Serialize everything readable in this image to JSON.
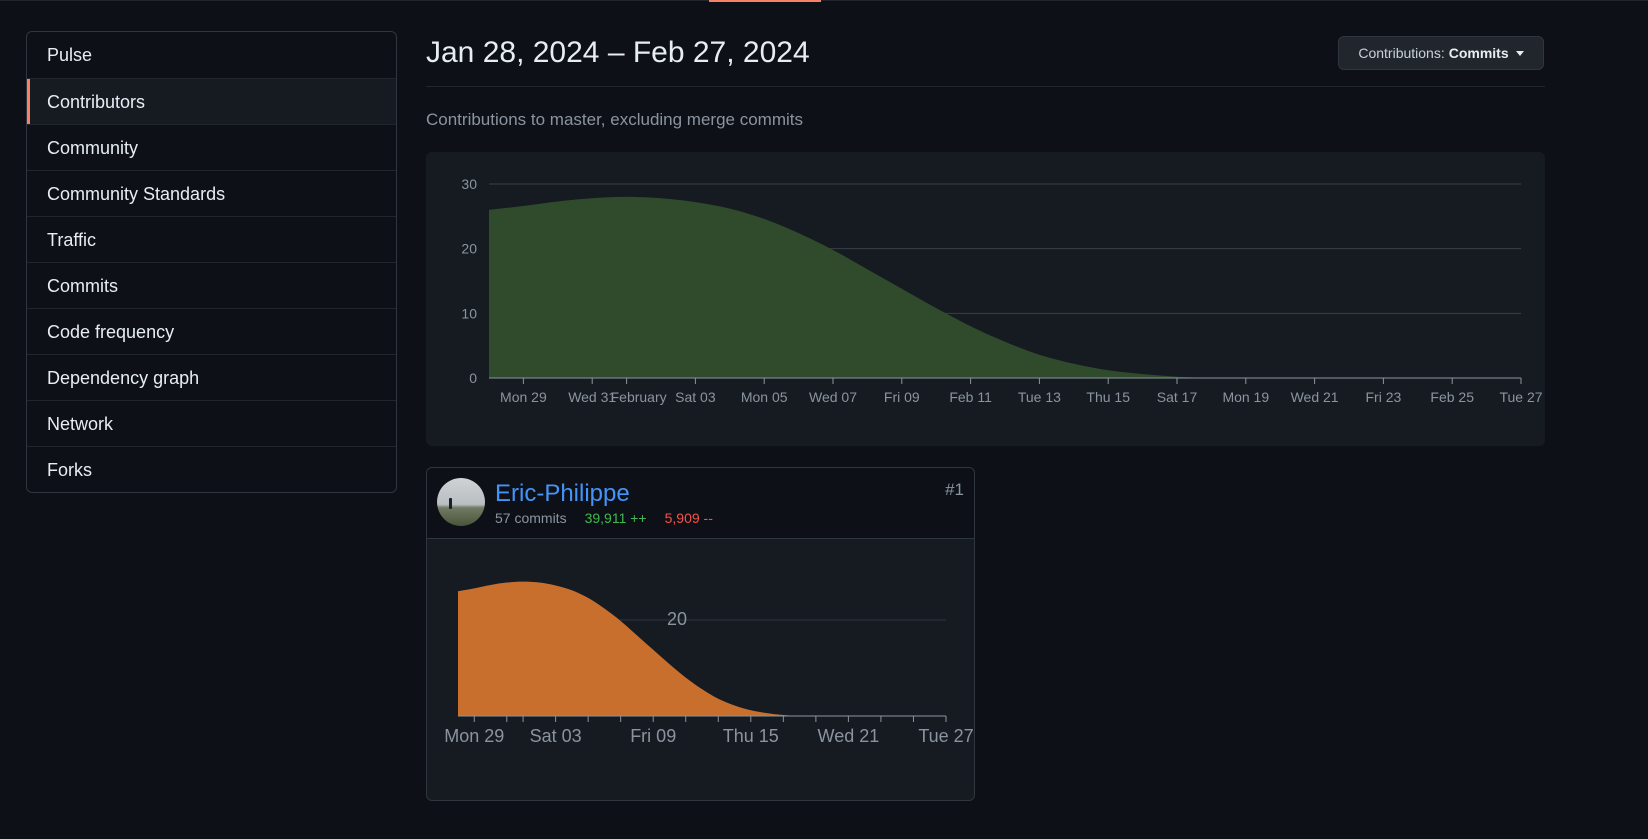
{
  "sidebar": {
    "items": [
      {
        "label": "Pulse",
        "active": false
      },
      {
        "label": "Contributors",
        "active": true
      },
      {
        "label": "Community",
        "active": false
      },
      {
        "label": "Community Standards",
        "active": false
      },
      {
        "label": "Traffic",
        "active": false
      },
      {
        "label": "Commits",
        "active": false
      },
      {
        "label": "Code frequency",
        "active": false
      },
      {
        "label": "Dependency graph",
        "active": false
      },
      {
        "label": "Network",
        "active": false
      },
      {
        "label": "Forks",
        "active": false
      }
    ]
  },
  "header": {
    "date_range": "Jan 28, 2024 – Feb 27, 2024",
    "contrib_prefix": "Contributions:",
    "contrib_value": "Commits",
    "subtitle": "Contributions to master, excluding merge commits"
  },
  "colors": {
    "accent": "#f78166",
    "overall_fill": "#2f4b2c",
    "contributor_fill": "#c96f2d",
    "link": "#4493f8",
    "additions": "#3fb950",
    "deletions": "#f85149"
  },
  "chart_data": [
    {
      "type": "area",
      "title": "",
      "xlabel": "",
      "ylabel": "",
      "ylim": [
        0,
        30
      ],
      "yticks": [
        0,
        10,
        20,
        30
      ],
      "grid": true,
      "xlim": [
        "Jan 28",
        "Feb 27"
      ],
      "xtick_labels": [
        "Mon 29",
        "Wed 31",
        "February",
        "Sat 03",
        "Mon 05",
        "Wed 07",
        "Fri 09",
        "Feb 11",
        "Tue 13",
        "Thu 15",
        "Sat 17",
        "Mon 19",
        "Wed 21",
        "Fri 23",
        "Feb 25",
        "Tue 27"
      ],
      "x": [
        "Jan 28",
        "Jan 29",
        "Jan 30",
        "Jan 31",
        "Feb 01",
        "Feb 02",
        "Feb 03",
        "Feb 04",
        "Feb 05",
        "Feb 06",
        "Feb 07",
        "Feb 08",
        "Feb 09",
        "Feb 10",
        "Feb 11",
        "Feb 12",
        "Feb 13",
        "Feb 14",
        "Feb 15",
        "Feb 16",
        "Feb 17",
        "Feb 18",
        "Feb 19",
        "Feb 20",
        "Feb 21",
        "Feb 22",
        "Feb 23",
        "Feb 24",
        "Feb 25",
        "Feb 26",
        "Feb 27"
      ],
      "series": [
        {
          "values": [
            26,
            26.6,
            27.3,
            27.8,
            28,
            27.8,
            27.2,
            26.2,
            24.6,
            22.4,
            19.8,
            16.8,
            13.8,
            10.8,
            8.0,
            5.6,
            3.6,
            2.2,
            1.2,
            0.6,
            0.2,
            0,
            0,
            0,
            0,
            0,
            0,
            0,
            0,
            0,
            0
          ]
        }
      ]
    },
    {
      "type": "area",
      "title": "",
      "xlabel": "",
      "ylabel": "",
      "ylim": [
        0,
        30
      ],
      "yticks": [
        20
      ],
      "grid": true,
      "xlim": [
        "Jan 28",
        "Feb 27"
      ],
      "xtick_labels": [
        "Mon 29",
        "Sat 03",
        "Fri 09",
        "Thu 15",
        "Wed 21",
        "Tue 27"
      ],
      "x": [
        "Jan 28",
        "Jan 29",
        "Jan 30",
        "Jan 31",
        "Feb 01",
        "Feb 02",
        "Feb 03",
        "Feb 04",
        "Feb 05",
        "Feb 06",
        "Feb 07",
        "Feb 08",
        "Feb 09",
        "Feb 10",
        "Feb 11",
        "Feb 12",
        "Feb 13",
        "Feb 14",
        "Feb 15",
        "Feb 16",
        "Feb 17",
        "Feb 18",
        "Feb 19",
        "Feb 20",
        "Feb 21",
        "Feb 22",
        "Feb 23",
        "Feb 24",
        "Feb 25",
        "Feb 26",
        "Feb 27"
      ],
      "series": [
        {
          "values": [
            26,
            26.6,
            27.3,
            27.8,
            28,
            27.8,
            27.2,
            26.2,
            24.6,
            22.4,
            19.8,
            16.8,
            13.8,
            10.8,
            8.0,
            5.6,
            3.6,
            2.2,
            1.2,
            0.6,
            0.2,
            0,
            0,
            0,
            0,
            0,
            0,
            0,
            0,
            0,
            0
          ]
        }
      ]
    }
  ],
  "contributor": {
    "name": "Eric-Philippe",
    "commits": "57 commits",
    "additions": "39,911 ++",
    "deletions": "5,909 --",
    "rank": "#1",
    "avatar_icon": "avatar-landscape-icon"
  }
}
